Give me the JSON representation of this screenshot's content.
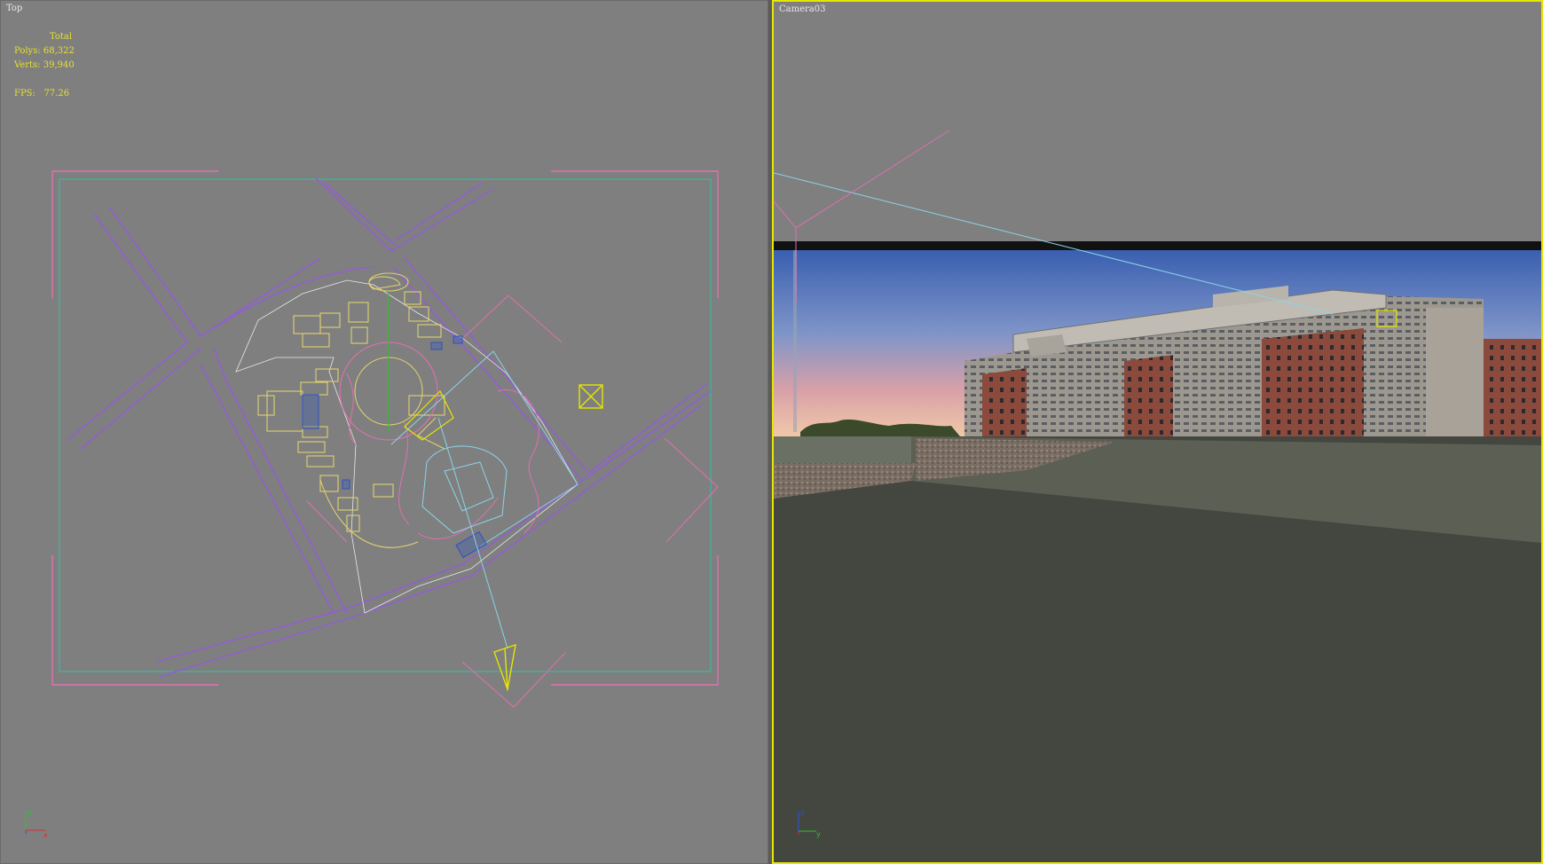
{
  "viewports": {
    "top": {
      "label": "Top",
      "stats": {
        "total_label": "Total",
        "polys_label": "Polys:",
        "polys_value": "68,322",
        "verts_label": "Verts:",
        "verts_value": "39,940",
        "fps_label": "FPS:",
        "fps_value": "77.26"
      },
      "axis": {
        "x": "x",
        "y": "y"
      }
    },
    "camera": {
      "label": "Camera03",
      "active": true,
      "axis": {
        "z": "z",
        "y": "y"
      }
    }
  },
  "colors": {
    "viewport_bg": "#7f7f7f",
    "active_border": "#e6e600",
    "stats_text": "#e8e030",
    "site_lines": "#e0d070",
    "road_lines": "#9060d0",
    "frame_lines": "#e070b0",
    "boundary": "#30c0a0"
  },
  "icons": {
    "camera": "camera-cone-icon",
    "light": "box-light-icon",
    "axis": "axis-tripod-icon"
  }
}
